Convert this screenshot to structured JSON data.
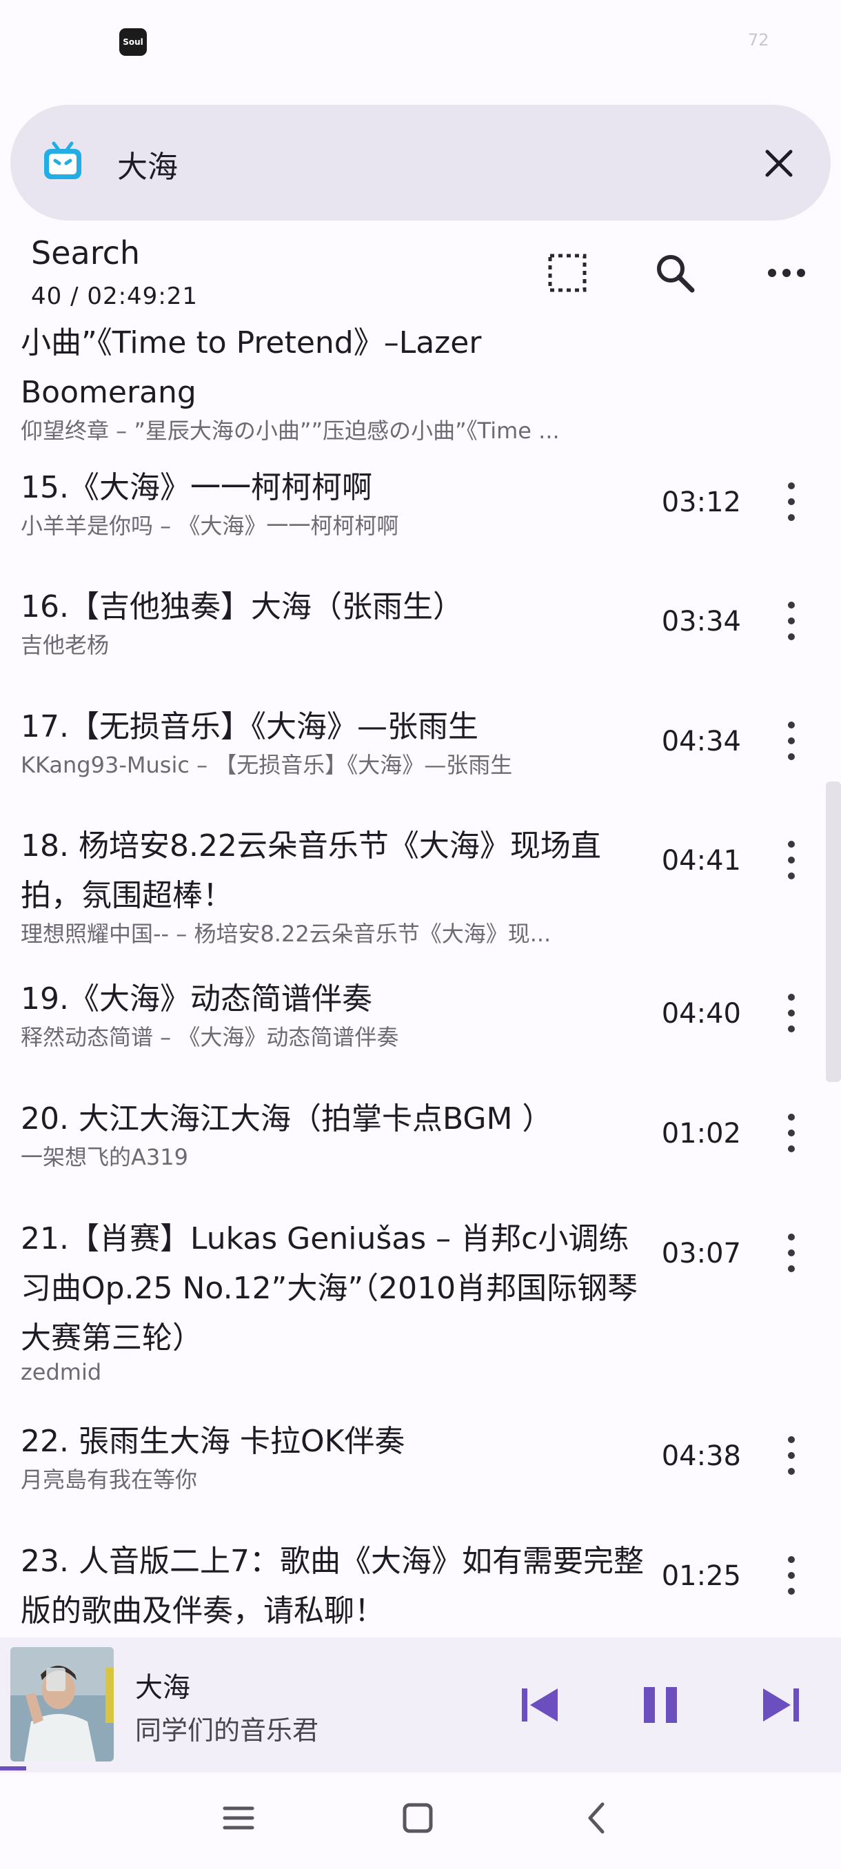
{
  "status_bar": {
    "app_icon_label": "Soul",
    "battery": "72"
  },
  "search": {
    "query": "大海"
  },
  "header": {
    "title": "Search",
    "subtitle": "40 / 02:49:21"
  },
  "results": [
    {
      "title": "小曲”《Time to Pretend》–Lazer Boomerang",
      "subtitle": "仰望终章 – ”星辰大海の小曲””压迫感の小曲”《Time ...",
      "duration": ""
    },
    {
      "title": "15.《大海》一一柯柯柯啊",
      "subtitle": "小羊羊是你吗 – 《大海》一一柯柯柯啊",
      "duration": "03:12"
    },
    {
      "title": "16.【吉他独奏】大海（张雨生）",
      "subtitle": "吉他老杨",
      "duration": "03:34"
    },
    {
      "title": "17.【无损音乐】《大海》—张雨生",
      "subtitle": "KKang93-Music – 【无损音乐】《大海》—张雨生",
      "duration": "04:34"
    },
    {
      "title": "18. 杨培安8.22云朵音乐节《大海》现场直拍，氛围超棒！",
      "subtitle": "理想照耀中国-- – 杨培安8.22云朵音乐节《大海》现...",
      "duration": "04:41"
    },
    {
      "title": "19.《大海》动态简谱伴奏",
      "subtitle": "释然动态简谱 – 《大海》动态简谱伴奏",
      "duration": "04:40"
    },
    {
      "title": "20. 大江大海江大海（拍掌卡点BGM ）",
      "subtitle": "一架想飞的A319",
      "duration": "01:02"
    },
    {
      "title": "21.【肖赛】Lukas Geniušas – 肖邦c小调练习曲Op.25 No.12”大海”（2010肖邦国际钢琴大赛第三轮）",
      "subtitle": "zedmid",
      "duration": "03:07"
    },
    {
      "title": "22. 張雨生大海 卡拉OK伴奏",
      "subtitle": "月亮島有我在等你",
      "duration": "04:38"
    },
    {
      "title": "23. 人音版二上7：歌曲《大海》如有需要完整版的歌曲及伴奏，请私聊！",
      "subtitle": "",
      "duration": "01:25"
    }
  ],
  "now_playing": {
    "title": "大海",
    "artist": "同学们的音乐君"
  },
  "colors": {
    "accent": "#6b4fbf",
    "search_bar_bg": "#e8e5f0",
    "player_bg": "#f2eff9",
    "bili_blue": "#23ade5"
  }
}
